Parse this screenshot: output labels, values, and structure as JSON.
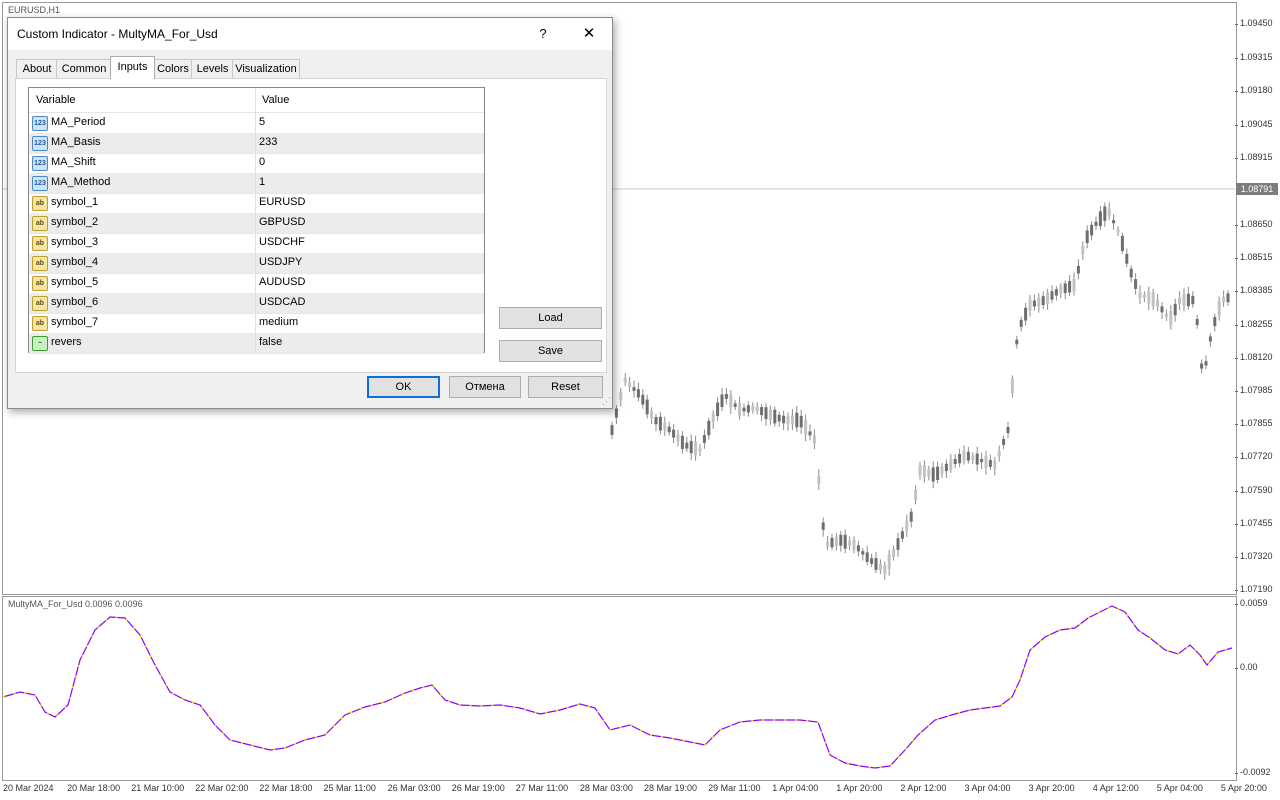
{
  "chart": {
    "window_label": "EURUSD,H1",
    "indicator_label": "MultyMA_For_Usd 0.0096 0.0096",
    "current_price": "1.08791",
    "price_ticks": [
      "1.09450",
      "1.09315",
      "1.09180",
      "1.09045",
      "1.08915",
      "1.08650",
      "1.08515",
      "1.08385",
      "1.08255",
      "1.08120",
      "1.07985",
      "1.07855",
      "1.07720",
      "1.07590",
      "1.07455",
      "1.07320",
      "1.07190"
    ],
    "indicator_ticks": [
      "0.0059",
      "0.00",
      "-0.0092"
    ],
    "time_ticks": [
      "20 Mar 2024",
      "20 Mar 18:00",
      "21 Mar 10:00",
      "22 Mar 02:00",
      "22 Mar 18:00",
      "25 Mar 11:00",
      "26 Mar 03:00",
      "26 Mar 19:00",
      "27 Mar 11:00",
      "28 Mar 03:00",
      "28 Mar 19:00",
      "29 Mar 11:00",
      "1 Apr 04:00",
      "1 Apr 20:00",
      "2 Apr 12:00",
      "3 Apr 04:00",
      "3 Apr 20:00",
      "4 Apr 12:00",
      "5 Apr 04:00",
      "5 Apr 20:00"
    ],
    "candle_color": "#808080",
    "line_colors": {
      "primary": "#8a00ff",
      "secondary": "#ffd700"
    }
  },
  "dialog": {
    "title": "Custom Indicator - MultyMA_For_Usd",
    "help": "?",
    "close": "✕",
    "tabs": [
      {
        "label": "About"
      },
      {
        "label": "Common"
      },
      {
        "label": "Inputs",
        "active": true
      },
      {
        "label": "Colors"
      },
      {
        "label": "Levels"
      },
      {
        "label": "Visualization"
      }
    ],
    "columns": {
      "variable": "Variable",
      "value": "Value"
    },
    "params": [
      {
        "icon": "123",
        "type": "number",
        "name": "MA_Period",
        "value": "5"
      },
      {
        "icon": "123",
        "type": "number",
        "name": "MA_Basis",
        "value": "233"
      },
      {
        "icon": "123",
        "type": "number",
        "name": "MA_Shift",
        "value": "0"
      },
      {
        "icon": "123",
        "type": "number",
        "name": "MA_Method",
        "value": "1"
      },
      {
        "icon": "ab",
        "type": "string",
        "name": "symbol_1",
        "value": "EURUSD"
      },
      {
        "icon": "ab",
        "type": "string",
        "name": "symbol_2",
        "value": "GBPUSD"
      },
      {
        "icon": "ab",
        "type": "string",
        "name": "symbol_3",
        "value": "USDCHF"
      },
      {
        "icon": "ab",
        "type": "string",
        "name": "symbol_4",
        "value": "USDJPY"
      },
      {
        "icon": "ab",
        "type": "string",
        "name": "symbol_5",
        "value": "AUDUSD"
      },
      {
        "icon": "ab",
        "type": "string",
        "name": "symbol_6",
        "value": "USDCAD"
      },
      {
        "icon": "ab",
        "type": "string",
        "name": "symbol_7",
        "value": "medium"
      },
      {
        "icon": "~",
        "type": "bool",
        "name": "revers",
        "value": "false"
      }
    ],
    "buttons": {
      "load": "Load",
      "save": "Save",
      "ok": "OK",
      "cancel": "Отмена",
      "reset": "Reset"
    }
  }
}
